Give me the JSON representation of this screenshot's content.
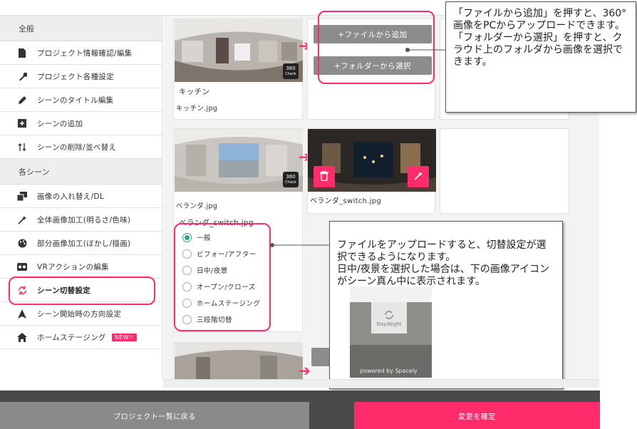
{
  "sidebar": {
    "section_general": "全般",
    "general_items": [
      {
        "label": "プロジェクト情報確認/編集",
        "icon": "document-icon"
      },
      {
        "label": "プロジェクト各種設定",
        "icon": "wrench-icon"
      },
      {
        "label": "シーンのタイトル編集",
        "icon": "pencil-icon"
      },
      {
        "label": "シーンの追加",
        "icon": "plus-square-icon"
      },
      {
        "label": "シーンの削除/並べ替え",
        "icon": "sort-icon"
      }
    ],
    "section_scene": "各シーン",
    "scene_items": [
      {
        "label": "画像の入れ替え/DL",
        "icon": "image-swap-icon"
      },
      {
        "label": "全体画像加工(明るさ/色味)",
        "icon": "magic-wand-icon"
      },
      {
        "label": "部分画像加工(ぼかし/描画)",
        "icon": "palette-icon"
      },
      {
        "label": "VRアクションの編集",
        "icon": "vr-icon"
      },
      {
        "label": "シーン切替設定",
        "icon": "refresh-icon"
      },
      {
        "label": "シーン開始時の方向設定",
        "icon": "direction-arrow-icon"
      },
      {
        "label": "ホームステージング",
        "icon": "home-icon",
        "badge": "NEW!!"
      }
    ]
  },
  "scenes": [
    {
      "title": "キッチン",
      "filename": "キッチン.jpg",
      "check_label": "360",
      "check_sub": "Check"
    },
    {
      "title": "ベランダ.jpg",
      "filename": "ベランダ_switch.jpg",
      "check_label": "360",
      "check_sub": "Check"
    }
  ],
  "upload": {
    "add_file": "+ファイルから追加",
    "add_folder": "+フォルダーから選択"
  },
  "switched": {
    "filename": "ベランダ_switch.jpg"
  },
  "radio_options": [
    "一般",
    "ビフォー/アフター",
    "日中/夜景",
    "オープン/クローズ",
    "ホームステージング",
    "三段階切替"
  ],
  "radio_selected": 0,
  "callouts": {
    "top": "「ファイルから追加」を押すと、360°画像をPCからアップロードできます。「フォルダーから選択」を押すと、クラウド上のフォルダから画像を選択できます。",
    "middle": "ファイルをアップロードすると、切替設定が選択できるようになります。\n日中/夜景を選択した場合は、下の画像アイコンがシーン真ん中に表示されます。",
    "preview_icon_label": "Day/Night",
    "preview_powered": "powered by Spacely"
  },
  "footer": {
    "back": "プロジェクト一覧に戻る",
    "confirm": "変更を確定"
  },
  "colors": {
    "accent": "#ff2b6b",
    "radio_on": "#2aa889"
  }
}
